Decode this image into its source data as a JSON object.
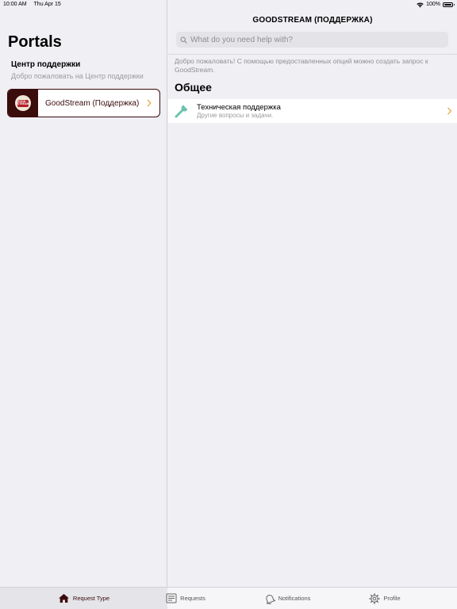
{
  "status_bar": {
    "time": "10:00 AM",
    "date": "Thu Apr 15",
    "battery": "100%",
    "icons": [
      "wifi-icon",
      "battery-icon"
    ]
  },
  "sidebar": {
    "title": "Portals",
    "section_title": "Центр поддержки",
    "section_subtitle": "Добро пожаловать на Центр поддержки",
    "portal": {
      "label": "GoodStream (Поддержка)",
      "logo_text": "GOOD STREAM",
      "icon": "chevron-right-icon"
    }
  },
  "main": {
    "title": "GOODSTREAM (ПОДДЕРЖКА)",
    "search": {
      "placeholder": "What do you need help with?",
      "value": ""
    },
    "welcome": "Добро пожаловать! С помощью предоставленных опций можно создать запрос к GoodStream.",
    "group_title": "Общее",
    "request_types": [
      {
        "title": "Техническая поддержка",
        "subtitle": "Другие вопросы и задачи.",
        "icon": "wrench-icon"
      }
    ]
  },
  "tabbar": {
    "tabs": [
      {
        "label": "Request Type",
        "icon": "home-icon",
        "active": true
      },
      {
        "label": "Requests",
        "icon": "requests-icon",
        "active": false
      },
      {
        "label": "Notifications",
        "icon": "bell-icon",
        "active": false
      },
      {
        "label": "Profile",
        "icon": "gear-icon",
        "active": false
      }
    ]
  },
  "colors": {
    "accent": "#3b0c0c",
    "chevron": "#e8a23a",
    "wrench": "#6cc3ac",
    "background": "#efeff4"
  }
}
